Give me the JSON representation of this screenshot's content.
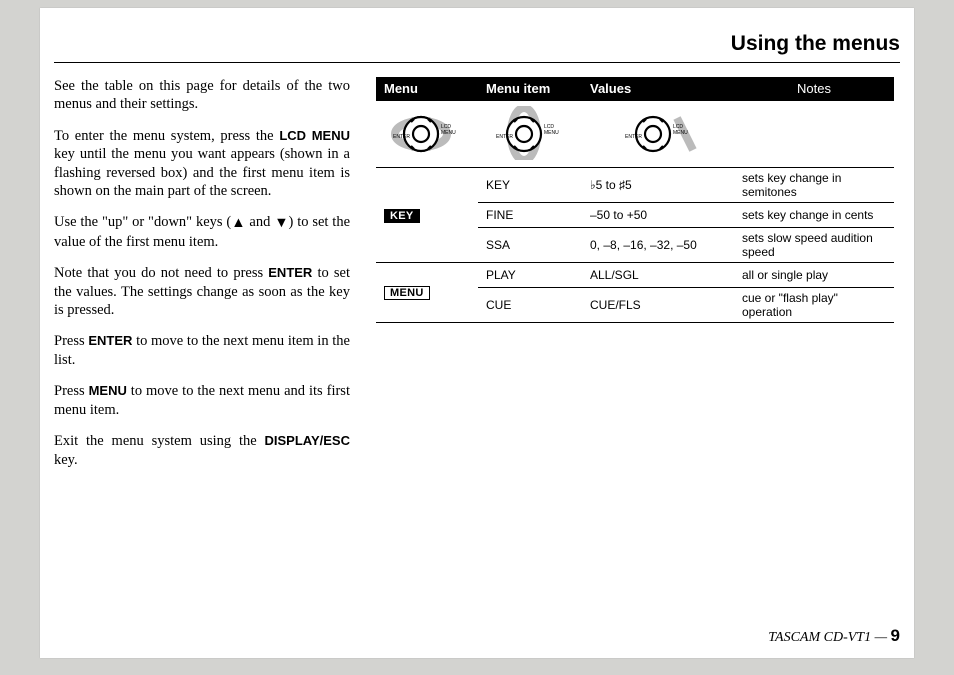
{
  "header": {
    "title": "Using the menus"
  },
  "body": {
    "p1": "See the table on this page for details of the two menus and their settings.",
    "p2a": "To enter the menu system, press the ",
    "p2key": "LCD MENU",
    "p2b": " key until the menu you want appears (shown in a flashing reversed box) and the first menu item is shown on the main part of the screen.",
    "p3a": "Use the \"up\" or \"down\" keys (",
    "p3b": " and ",
    "p3c": ") to set the value of the first menu item.",
    "p4a": "Note that you do not need to press ",
    "p4key": "ENTER",
    "p4b": " to set the values. The settings change as soon as the key is pressed.",
    "p5a": "Press ",
    "p5key": "ENTER",
    "p5b": " to move to the next menu item in the list.",
    "p6a": "Press ",
    "p6key": "MENU",
    "p6b": " to move to the next menu and its first menu item.",
    "p7a": "Exit the menu system using the ",
    "p7key": "DISPLAY/ESC",
    "p7b": " key."
  },
  "table": {
    "head": {
      "c1": "Menu",
      "c2": "Menu item",
      "c3": "Values",
      "c4": "Notes"
    },
    "labels": {
      "key": "KEY",
      "menu": "MENU"
    },
    "rows": [
      {
        "item": "KEY",
        "values": "♭5 to ♯5",
        "notes": "sets key change in semitones"
      },
      {
        "item": "FINE",
        "values": "–50 to +50",
        "notes": "sets key change in cents"
      },
      {
        "item": "SSA",
        "values": "0, –8, –16, –32, –50",
        "notes": "sets slow speed audition speed"
      },
      {
        "item": "PLAY",
        "values": "ALL/SGL",
        "notes": "all or single play"
      },
      {
        "item": "CUE",
        "values": "CUE/FLS",
        "notes": "cue or \"flash play\" operation"
      }
    ],
    "iconLabels": {
      "enter": "ENTER",
      "lcdmenu": "LCD MENU"
    }
  },
  "footer": {
    "text": "TASCAM CD-VT1 — ",
    "page": "9"
  }
}
